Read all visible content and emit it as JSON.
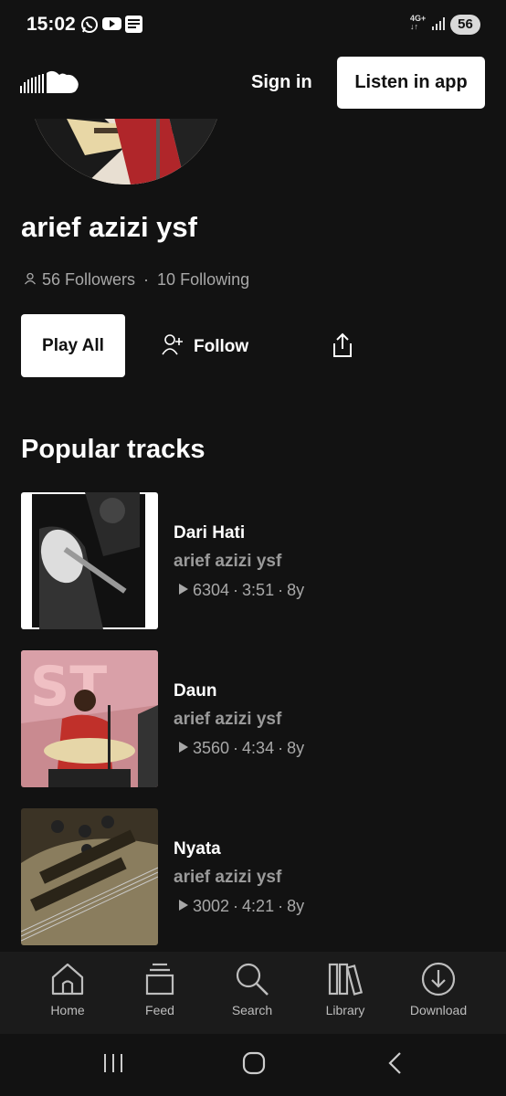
{
  "status_bar": {
    "time": "15:02",
    "icons": [
      "whatsapp-icon",
      "youtube-icon",
      "bri-mo-icon"
    ],
    "network": "4G+",
    "battery": "56"
  },
  "header": {
    "logo": "soundcloud-logo",
    "sign_in": "Sign in",
    "listen_in_app": "Listen in app"
  },
  "profile": {
    "name": "arief azizi ysf",
    "followers": "56 Followers",
    "following": "10 Following",
    "separator": "·"
  },
  "actions": {
    "play_all": "Play All",
    "follow": "Follow"
  },
  "popular_tracks": {
    "title": "Popular tracks",
    "items": [
      {
        "title": "Dari Hati",
        "artist": "arief azizi ysf",
        "plays": "6304",
        "duration": "3:51",
        "age": "8y"
      },
      {
        "title": "Daun",
        "artist": "arief azizi ysf",
        "plays": "3560",
        "duration": "4:34",
        "age": "8y"
      },
      {
        "title": "Nyata",
        "artist": "arief azizi ysf",
        "plays": "3002",
        "duration": "4:21",
        "age": "8y"
      }
    ]
  },
  "bottom_nav": [
    {
      "label": "Home",
      "icon": "home-icon"
    },
    {
      "label": "Feed",
      "icon": "feed-icon"
    },
    {
      "label": "Search",
      "icon": "search-icon"
    },
    {
      "label": "Library",
      "icon": "library-icon"
    },
    {
      "label": "Download",
      "icon": "download-icon"
    }
  ],
  "colors": {
    "background": "#121212",
    "primary_text": "#ffffff",
    "secondary_text": "#a8a8a8",
    "button_bg": "#ffffff"
  }
}
